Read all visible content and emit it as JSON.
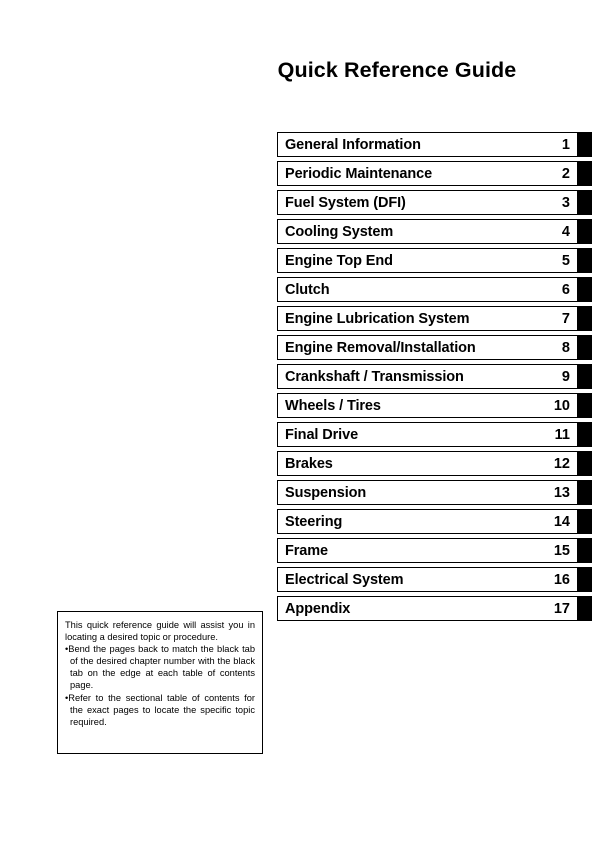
{
  "document": {
    "title": "Quick Reference Guide"
  },
  "chapters": [
    {
      "label": "General Information",
      "number": "1"
    },
    {
      "label": "Periodic Maintenance",
      "number": "2"
    },
    {
      "label": "Fuel System (DFI)",
      "number": "3"
    },
    {
      "label": "Cooling System",
      "number": "4"
    },
    {
      "label": "Engine Top End",
      "number": "5"
    },
    {
      "label": "Clutch",
      "number": "6"
    },
    {
      "label": "Engine Lubrication System",
      "number": "7"
    },
    {
      "label": "Engine Removal/Installation",
      "number": "8"
    },
    {
      "label": "Crankshaft / Transmission",
      "number": "9"
    },
    {
      "label": "Wheels / Tires",
      "number": "10"
    },
    {
      "label": "Final Drive",
      "number": "11"
    },
    {
      "label": "Brakes",
      "number": "12"
    },
    {
      "label": "Suspension",
      "number": "13"
    },
    {
      "label": "Steering",
      "number": "14"
    },
    {
      "label": "Frame",
      "number": "15"
    },
    {
      "label": "Electrical System",
      "number": "16"
    },
    {
      "label": "Appendix",
      "number": "17"
    }
  ],
  "note": {
    "intro": "This quick reference guide will assist you in locating a desired topic or procedure.",
    "bullets": [
      "•Bend the pages back to match the black tab of the desired chapter number with the black tab on the edge at each table of contents page.",
      "•Refer to the sectional table of contents for the exact pages to locate the specific topic required."
    ]
  },
  "colors": {
    "ink": "#000000",
    "paper": "#ffffff",
    "tab": "#000000"
  }
}
